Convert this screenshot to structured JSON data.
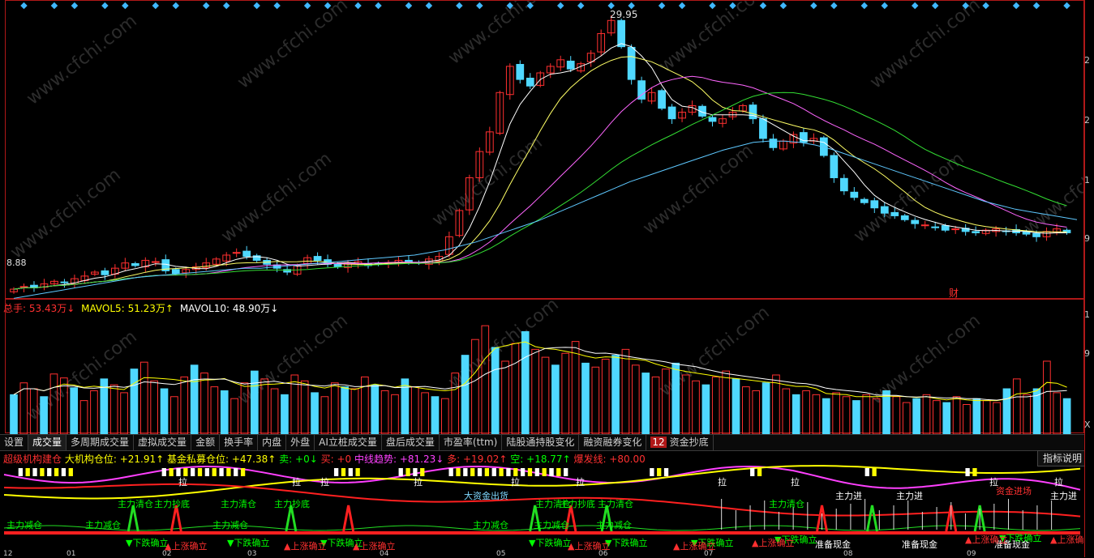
{
  "chart_data": [
    {
      "type": "candlestick",
      "title": "",
      "xlabel": "",
      "ylabel": "",
      "ylim": [
        8.2,
        31
      ],
      "high_label": "29.95",
      "low_label": "8.88",
      "ticks_right": [
        "2",
        "2",
        "2",
        "1",
        "9"
      ],
      "moving_averages": [
        "MA5",
        "MA10",
        "MA20",
        "MA60"
      ],
      "close_series": [
        9.0,
        9.2,
        9.1,
        9.4,
        9.6,
        9.5,
        9.8,
        10.0,
        10.3,
        10.1,
        10.6,
        11.0,
        10.8,
        11.2,
        11.1,
        10.4,
        10.2,
        10.5,
        10.7,
        11.0,
        11.3,
        11.6,
        11.8,
        11.5,
        11.2,
        10.9,
        10.6,
        10.3,
        10.8,
        11.4,
        11.2,
        10.9,
        10.7,
        11.0,
        11.1,
        10.8,
        10.9,
        11.0,
        11.2,
        11.1,
        11.0,
        11.3,
        11.5,
        13.0,
        15.0,
        17.5,
        19.5,
        21.0,
        24.0,
        26.0,
        25.0,
        24.5,
        25.5,
        26.0,
        26.5,
        25.8,
        26.2,
        27.0,
        28.5,
        29.5,
        27.5,
        25.0,
        23.5,
        24.0,
        22.8,
        22.0,
        22.5,
        23.0,
        22.2,
        21.8,
        22.0,
        22.5,
        23.0,
        22.0,
        20.5,
        19.8,
        20.3,
        20.8,
        20.2,
        20.5,
        19.2,
        17.5,
        16.5,
        16.0,
        15.6,
        15.2,
        14.8,
        14.6,
        14.3,
        14.0,
        13.9,
        13.7,
        13.5,
        13.6,
        13.4,
        13.3,
        13.5,
        13.6,
        13.4,
        13.3,
        13.2,
        13.0,
        13.4,
        13.6,
        13.3
      ],
      "ma60_series": [
        8.3,
        8.5,
        8.7,
        8.9,
        9.1,
        9.3,
        9.5,
        9.7,
        9.9,
        10.0,
        10.1,
        10.2,
        10.3,
        10.4,
        10.5,
        10.6,
        10.6,
        10.7,
        10.8,
        10.9,
        11.0,
        11.1,
        11.2,
        11.3,
        11.4,
        11.5,
        11.6,
        11.8,
        12.0,
        12.3,
        12.6,
        13.0,
        13.4,
        13.8,
        14.2,
        14.7,
        15.2,
        15.7,
        16.2,
        16.7,
        17.2,
        17.6,
        18.0,
        18.4,
        18.8,
        19.2,
        19.6,
        19.9,
        20.2,
        20.3,
        20.3,
        20.2,
        20.0,
        19.7,
        19.3,
        18.9,
        18.5,
        18.1,
        17.7,
        17.3,
        16.9,
        16.5,
        16.1,
        15.7,
        15.4,
        15.1,
        14.9,
        14.7,
        14.5,
        14.3
      ]
    },
    {
      "type": "bar",
      "title": "",
      "legend": [
        {
          "name": "总手:",
          "value": "53.43万↓",
          "color": "#ffffff"
        },
        {
          "name": "MAVOL5:",
          "value": "51.23万↑",
          "color": "#ffff00"
        },
        {
          "name": "MAVOL10:",
          "value": "48.90万↓",
          "color": "#ffffff"
        }
      ],
      "ticks_right": [
        "1",
        "9",
        "X"
      ],
      "values": [
        40,
        52,
        46,
        38,
        61,
        57,
        47,
        34,
        44,
        56,
        50,
        42,
        66,
        73,
        54,
        46,
        38,
        58,
        70,
        62,
        48,
        44,
        36,
        52,
        64,
        56,
        46,
        40,
        60,
        54,
        42,
        38,
        52,
        48,
        46,
        58,
        50,
        44,
        40,
        56,
        48,
        42,
        38,
        36,
        62,
        80,
        96,
        110,
        88,
        74,
        92,
        104,
        86,
        78,
        70,
        82,
        94,
        72,
        68,
        76,
        80,
        86,
        70,
        62,
        58,
        66,
        72,
        60,
        54,
        50,
        58,
        64,
        56,
        48,
        44,
        52,
        60,
        46,
        40,
        44,
        40,
        36,
        42,
        38,
        34,
        40,
        36,
        44,
        38,
        32,
        36,
        40,
        34,
        32,
        38,
        30,
        36,
        34,
        32,
        46,
        56,
        40,
        46,
        74,
        42,
        36
      ],
      "colors_up_down": [
        "#ff3030",
        "#4fd8ff"
      ]
    }
  ],
  "tabs": [
    "设置",
    "成交量",
    "多周期成交量",
    "虚拟成交量",
    "金额",
    "换手率",
    "内盘",
    "外盘",
    "AI立桩成交量",
    "盘后成交量",
    "市盈率(ttm)",
    "陆股通持股变化",
    "融资融券变化",
    "资金抄底"
  ],
  "tab_badge": "12",
  "help_button": "指标说明",
  "indicator_legend": [
    {
      "text": "超级机构建仓",
      "color": "#ff3030"
    },
    {
      "text": "大机构仓位: +21.91↑",
      "color": "#ffff00"
    },
    {
      "text": "基金私募仓位: +47.38↑",
      "color": "#ffff00"
    },
    {
      "text": "卖: +0↓",
      "color": "#00ff00"
    },
    {
      "text": "买: +0",
      "color": "#ff3030"
    },
    {
      "text": "中线趋势: +81.23↓",
      "color": "#ff40ff"
    },
    {
      "text": "多: +19.02↑",
      "color": "#ff3030"
    },
    {
      "text": "空: +18.77↑",
      "color": "#00ff00"
    },
    {
      "text": "爆发线: +80.00",
      "color": "#ff3030"
    }
  ],
  "indicator_signals": [
    {
      "text": "主力减仓",
      "color": "#00ff00"
    },
    {
      "text": "主力清仓",
      "color": "#00ff00"
    },
    {
      "text": "主力抄底",
      "color": "#00ff00"
    },
    {
      "text": "大资金出货",
      "color": "#7fd8ff"
    },
    {
      "text": "主力进",
      "color": "#ffffff"
    },
    {
      "text": "资金进场",
      "color": "#ff3030"
    },
    {
      "text": "准备现金",
      "color": "#ffffff"
    },
    {
      "text": "▼下跌确立",
      "color": "#00ff00"
    },
    {
      "text": "▲上涨确立",
      "color": "#ff3030"
    },
    {
      "text": "拉",
      "color": "#ffffff"
    }
  ],
  "date_labels": [
    "12",
    "01",
    "02",
    "03",
    "04",
    "05",
    "06",
    "07",
    "08",
    "09"
  ],
  "fin_badge": "财",
  "watermark": "www.cfchi.com"
}
